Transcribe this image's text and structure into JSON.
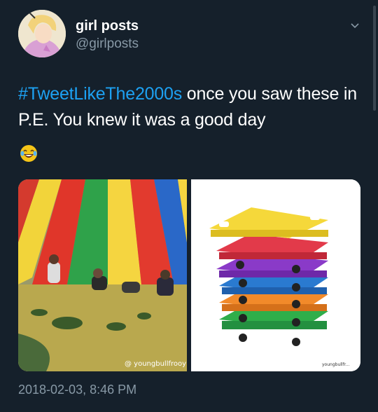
{
  "user": {
    "display_name": "girl posts",
    "handle": "@girlposts"
  },
  "tweet": {
    "hashtag": "#TweetLikeThe2000s",
    "text_after_hashtag": " once you saw these in P.E. You knew it was a good day",
    "emoji": "face-with-tears-of-joy",
    "timestamp": "2018-02-03, 8:46 PM"
  },
  "media": {
    "left_watermark": "@ youngbullfrooy",
    "right_watermark": "youngbullfr..."
  },
  "icons": {
    "menu": "chevron-down-icon"
  },
  "colors": {
    "background": "#15202b",
    "hashtag": "#1da1f2",
    "secondary_text": "#8899a6"
  }
}
